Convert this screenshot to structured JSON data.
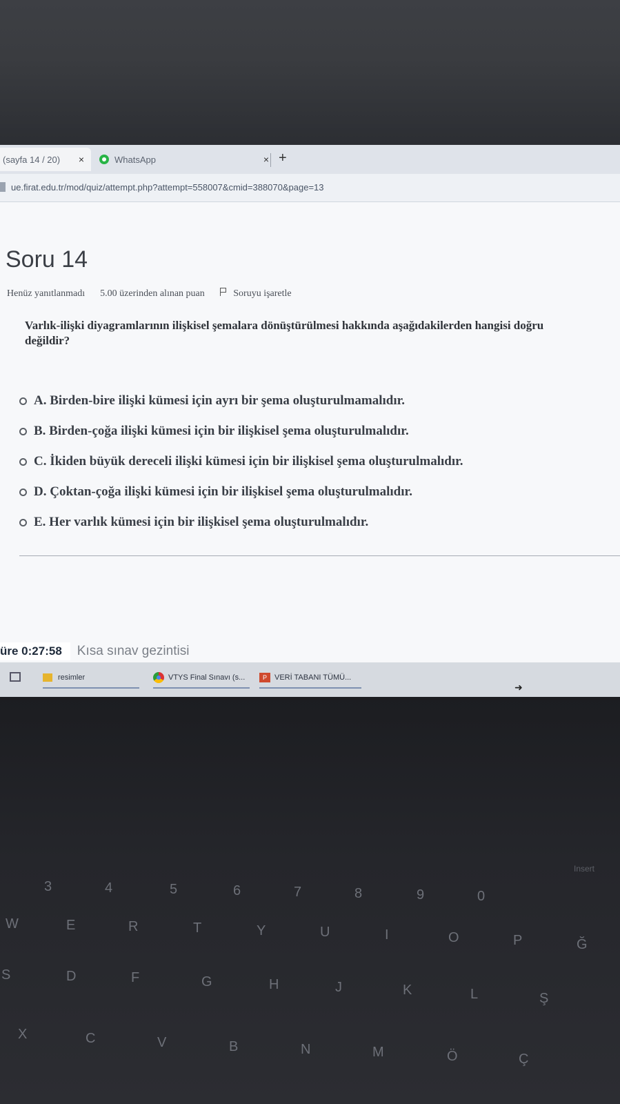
{
  "browser": {
    "tabs": [
      {
        "label": "(sayfa 14 / 20)",
        "close": "×",
        "active": true
      },
      {
        "label": "WhatsApp",
        "close": "×",
        "active": false
      }
    ],
    "new_tab": "+",
    "url": "ue.firat.edu.tr/mod/quiz/attempt.php?attempt=558007&cmid=388070&page=13"
  },
  "question": {
    "title": "Soru 14",
    "status": "Henüz yanıtlanmadı",
    "points": "5.00 üzerinden alınan puan",
    "flag_label": "Soruyu işaretle",
    "text": "Varlık-ilişki diyagramlarının ilişkisel şemalara dönüştürülmesi hakkında aşağıdakilerden hangisi doğru değildir?",
    "answers": [
      "A. Birden-bire ilişki kümesi için ayrı bir şema oluşturulmamalıdır.",
      "B. Birden-çoğa ilişki kümesi için bir ilişkisel şema oluşturulmalıdır.",
      "C. İkiden büyük dereceli ilişki kümesi için bir ilişkisel şema oluşturulmalıdır.",
      "D. Çoktan-çoğa ilişki kümesi için bir ilişkisel şema oluşturulmalıdır.",
      "E. Her varlık kümesi için bir ilişkisel şema oluşturulmalıdır."
    ]
  },
  "quiz_nav": {
    "timer": "üre 0:27:58",
    "nav_label": "Kısa sınav gezintisi"
  },
  "taskbar": {
    "items": [
      "resimler",
      "VTYS Final Sınavı (s...",
      "VERİ TABANI TÜMÜ..."
    ]
  },
  "keyboard": {
    "keys": [
      "3",
      "4",
      "5",
      "6",
      "7",
      "8",
      "9",
      "0",
      "W",
      "E",
      "R",
      "T",
      "Y",
      "U",
      "I",
      "O",
      "P",
      "Ğ",
      "S",
      "D",
      "F",
      "G",
      "H",
      "J",
      "K",
      "L",
      "Ş",
      "X",
      "C",
      "V",
      "B",
      "N",
      "M",
      "Ö",
      "Ç",
      "Insert"
    ]
  }
}
